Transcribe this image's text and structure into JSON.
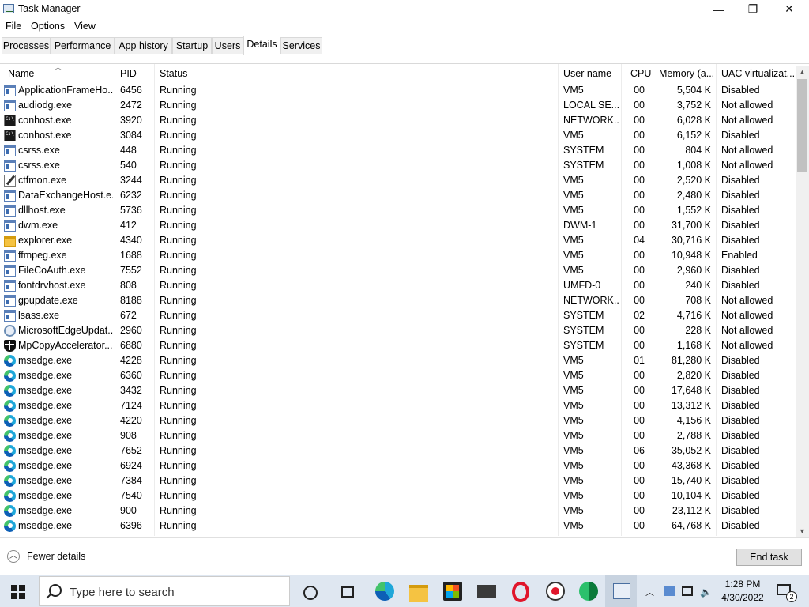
{
  "window": {
    "title": "Task Manager",
    "minimize": "—",
    "maximize": "❐",
    "close": "✕"
  },
  "menu": [
    "File",
    "Options",
    "View"
  ],
  "tabs": [
    {
      "label": "Processes"
    },
    {
      "label": "Performance"
    },
    {
      "label": "App history"
    },
    {
      "label": "Startup"
    },
    {
      "label": "Users"
    },
    {
      "label": "Details",
      "active": true
    },
    {
      "label": "Services"
    }
  ],
  "columns": {
    "name": "Name",
    "pid": "PID",
    "status": "Status",
    "user": "User name",
    "cpu": "CPU",
    "memory": "Memory (a...",
    "uac": "UAC virtualizat..."
  },
  "processes": [
    {
      "icon": "app",
      "name": "ApplicationFrameHo...",
      "pid": "6456",
      "status": "Running",
      "user": "VM5",
      "cpu": "00",
      "memory": "5,504 K",
      "uac": "Disabled"
    },
    {
      "icon": "app",
      "name": "audiodg.exe",
      "pid": "2472",
      "status": "Running",
      "user": "LOCAL SE...",
      "cpu": "00",
      "memory": "3,752 K",
      "uac": "Not allowed"
    },
    {
      "icon": "console",
      "name": "conhost.exe",
      "pid": "3920",
      "status": "Running",
      "user": "NETWORK...",
      "cpu": "00",
      "memory": "6,028 K",
      "uac": "Not allowed"
    },
    {
      "icon": "console",
      "name": "conhost.exe",
      "pid": "3084",
      "status": "Running",
      "user": "VM5",
      "cpu": "00",
      "memory": "6,152 K",
      "uac": "Disabled"
    },
    {
      "icon": "app",
      "name": "csrss.exe",
      "pid": "448",
      "status": "Running",
      "user": "SYSTEM",
      "cpu": "00",
      "memory": "804 K",
      "uac": "Not allowed"
    },
    {
      "icon": "app",
      "name": "csrss.exe",
      "pid": "540",
      "status": "Running",
      "user": "SYSTEM",
      "cpu": "00",
      "memory": "1,008 K",
      "uac": "Not allowed"
    },
    {
      "icon": "pen",
      "name": "ctfmon.exe",
      "pid": "3244",
      "status": "Running",
      "user": "VM5",
      "cpu": "00",
      "memory": "2,520 K",
      "uac": "Disabled"
    },
    {
      "icon": "app",
      "name": "DataExchangeHost.e...",
      "pid": "6232",
      "status": "Running",
      "user": "VM5",
      "cpu": "00",
      "memory": "2,480 K",
      "uac": "Disabled"
    },
    {
      "icon": "app",
      "name": "dllhost.exe",
      "pid": "5736",
      "status": "Running",
      "user": "VM5",
      "cpu": "00",
      "memory": "1,552 K",
      "uac": "Disabled"
    },
    {
      "icon": "app",
      "name": "dwm.exe",
      "pid": "412",
      "status": "Running",
      "user": "DWM-1",
      "cpu": "00",
      "memory": "31,700 K",
      "uac": "Disabled"
    },
    {
      "icon": "folder",
      "name": "explorer.exe",
      "pid": "4340",
      "status": "Running",
      "user": "VM5",
      "cpu": "04",
      "memory": "30,716 K",
      "uac": "Disabled"
    },
    {
      "icon": "app",
      "name": "ffmpeg.exe",
      "pid": "1688",
      "status": "Running",
      "user": "VM5",
      "cpu": "00",
      "memory": "10,948 K",
      "uac": "Enabled"
    },
    {
      "icon": "app",
      "name": "FileCoAuth.exe",
      "pid": "7552",
      "status": "Running",
      "user": "VM5",
      "cpu": "00",
      "memory": "2,960 K",
      "uac": "Disabled"
    },
    {
      "icon": "app",
      "name": "fontdrvhost.exe",
      "pid": "808",
      "status": "Running",
      "user": "UMFD-0",
      "cpu": "00",
      "memory": "240 K",
      "uac": "Disabled"
    },
    {
      "icon": "app",
      "name": "gpupdate.exe",
      "pid": "8188",
      "status": "Running",
      "user": "NETWORK...",
      "cpu": "00",
      "memory": "708 K",
      "uac": "Not allowed"
    },
    {
      "icon": "app",
      "name": "lsass.exe",
      "pid": "672",
      "status": "Running",
      "user": "SYSTEM",
      "cpu": "02",
      "memory": "4,716 K",
      "uac": "Not allowed"
    },
    {
      "icon": "update",
      "name": "MicrosoftEdgeUpdat...",
      "pid": "2960",
      "status": "Running",
      "user": "SYSTEM",
      "cpu": "00",
      "memory": "228 K",
      "uac": "Not allowed"
    },
    {
      "icon": "shield",
      "name": "MpCopyAccelerator....",
      "pid": "6880",
      "status": "Running",
      "user": "SYSTEM",
      "cpu": "00",
      "memory": "1,168 K",
      "uac": "Not allowed"
    },
    {
      "icon": "edge",
      "name": "msedge.exe",
      "pid": "4228",
      "status": "Running",
      "user": "VM5",
      "cpu": "01",
      "memory": "81,280 K",
      "uac": "Disabled"
    },
    {
      "icon": "edge",
      "name": "msedge.exe",
      "pid": "6360",
      "status": "Running",
      "user": "VM5",
      "cpu": "00",
      "memory": "2,820 K",
      "uac": "Disabled"
    },
    {
      "icon": "edge",
      "name": "msedge.exe",
      "pid": "3432",
      "status": "Running",
      "user": "VM5",
      "cpu": "00",
      "memory": "17,648 K",
      "uac": "Disabled"
    },
    {
      "icon": "edge",
      "name": "msedge.exe",
      "pid": "7124",
      "status": "Running",
      "user": "VM5",
      "cpu": "00",
      "memory": "13,312 K",
      "uac": "Disabled"
    },
    {
      "icon": "edge",
      "name": "msedge.exe",
      "pid": "4220",
      "status": "Running",
      "user": "VM5",
      "cpu": "00",
      "memory": "4,156 K",
      "uac": "Disabled"
    },
    {
      "icon": "edge",
      "name": "msedge.exe",
      "pid": "908",
      "status": "Running",
      "user": "VM5",
      "cpu": "00",
      "memory": "2,788 K",
      "uac": "Disabled"
    },
    {
      "icon": "edge",
      "name": "msedge.exe",
      "pid": "7652",
      "status": "Running",
      "user": "VM5",
      "cpu": "06",
      "memory": "35,052 K",
      "uac": "Disabled"
    },
    {
      "icon": "edge",
      "name": "msedge.exe",
      "pid": "6924",
      "status": "Running",
      "user": "VM5",
      "cpu": "00",
      "memory": "43,368 K",
      "uac": "Disabled"
    },
    {
      "icon": "edge",
      "name": "msedge.exe",
      "pid": "7384",
      "status": "Running",
      "user": "VM5",
      "cpu": "00",
      "memory": "15,740 K",
      "uac": "Disabled"
    },
    {
      "icon": "edge",
      "name": "msedge.exe",
      "pid": "7540",
      "status": "Running",
      "user": "VM5",
      "cpu": "00",
      "memory": "10,104 K",
      "uac": "Disabled"
    },
    {
      "icon": "edge",
      "name": "msedge.exe",
      "pid": "900",
      "status": "Running",
      "user": "VM5",
      "cpu": "00",
      "memory": "23,112 K",
      "uac": "Disabled"
    },
    {
      "icon": "edge",
      "name": "msedge.exe",
      "pid": "6396",
      "status": "Running",
      "user": "VM5",
      "cpu": "00",
      "memory": "64,768 K",
      "uac": "Disabled"
    }
  ],
  "footer": {
    "fewer_details": "Fewer details",
    "end_task": "End task"
  },
  "taskbar": {
    "search_placeholder": "Type here to search",
    "time": "1:28 PM",
    "date": "4/30/2022",
    "notification_count": "2"
  }
}
